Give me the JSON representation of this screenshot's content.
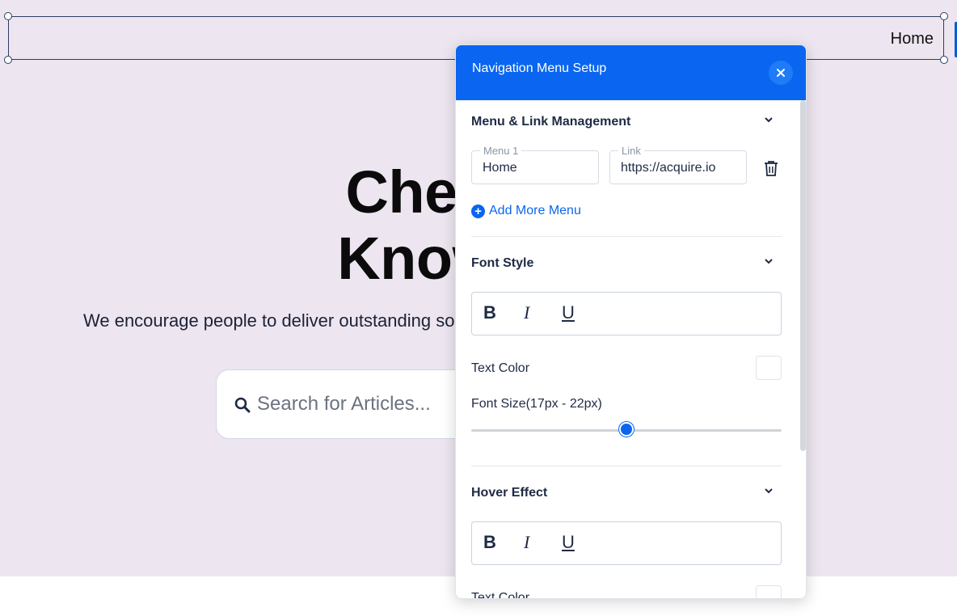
{
  "nav": {
    "home_label": "Home"
  },
  "hero": {
    "title_line1": "Check ou",
    "title_line2": "Knowledg",
    "subtitle": "We encourage people to deliver outstanding so",
    "search_placeholder": "Search for Articles..."
  },
  "panel": {
    "title": "Navigation Menu Setup",
    "menu_section": {
      "title": "Menu & Link Management",
      "menu_label": "Menu 1",
      "menu_value": "Home",
      "link_label": "Link",
      "link_value": "https://acquire.io",
      "add_label": "Add More Menu"
    },
    "font_style": {
      "title": "Font Style",
      "bold": "B",
      "italic": "I",
      "underline": "U",
      "text_color_label": "Text Color",
      "text_color": "#ffffff",
      "font_size_label": "Font Size(17px - 22px)",
      "font_size_level": 0.5
    },
    "hover_effect": {
      "title": "Hover Effect",
      "bold": "B",
      "italic": "I",
      "underline": "U",
      "text_color_label": "Text Color"
    }
  },
  "colors": {
    "accent": "#0a66f0",
    "hero_bg": "#ede5ef"
  }
}
